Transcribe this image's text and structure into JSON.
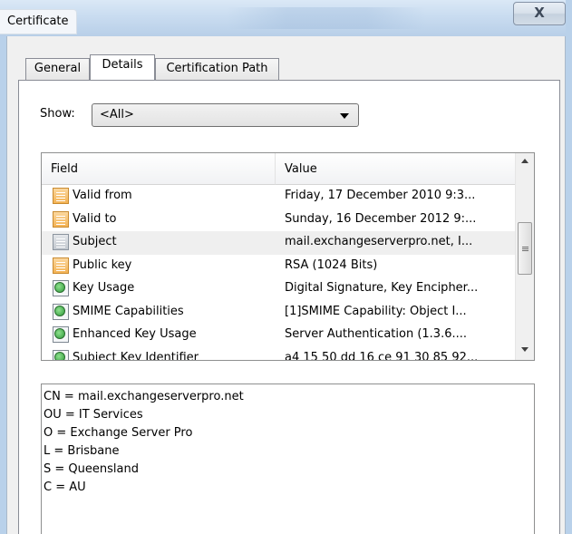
{
  "window": {
    "title": "Certificate",
    "close_symbol": "X"
  },
  "tabs": [
    {
      "label": "General",
      "active": false
    },
    {
      "label": "Details",
      "active": true
    },
    {
      "label": "Certification Path",
      "active": false
    }
  ],
  "show": {
    "label": "Show:",
    "selected": "<All>"
  },
  "list": {
    "columns": {
      "field": "Field",
      "value": "Value"
    },
    "rows": [
      {
        "field": "Valid from",
        "value": "Friday, 17 December 2010 9:3...",
        "icon": "certificate-field-icon"
      },
      {
        "field": "Valid to",
        "value": "Sunday, 16 December 2012 9:...",
        "icon": "certificate-field-icon"
      },
      {
        "field": "Subject",
        "value": "mail.exchangeserverpro.net, I...",
        "icon": "certificate-field-icon",
        "selected": true
      },
      {
        "field": "Public key",
        "value": "RSA (1024 Bits)",
        "icon": "certificate-field-icon"
      },
      {
        "field": "Key Usage",
        "value": "Digital Signature, Key Encipher...",
        "icon": "extension-icon"
      },
      {
        "field": "SMIME Capabilities",
        "value": "[1]SMIME Capability: Object I...",
        "icon": "extension-icon"
      },
      {
        "field": "Enhanced Key Usage",
        "value": "Server Authentication (1.3.6....",
        "icon": "extension-icon"
      },
      {
        "field": "Subject Key Identifier",
        "value": "a4 15 50 dd 16 ce 91 30 85 92...",
        "icon": "extension-icon"
      }
    ]
  },
  "details": {
    "lines": [
      "CN = mail.exchangeserverpro.net",
      "OU = IT Services",
      "O = Exchange Server Pro",
      "L = Brisbane",
      "S = Queensland",
      "C = AU"
    ]
  }
}
